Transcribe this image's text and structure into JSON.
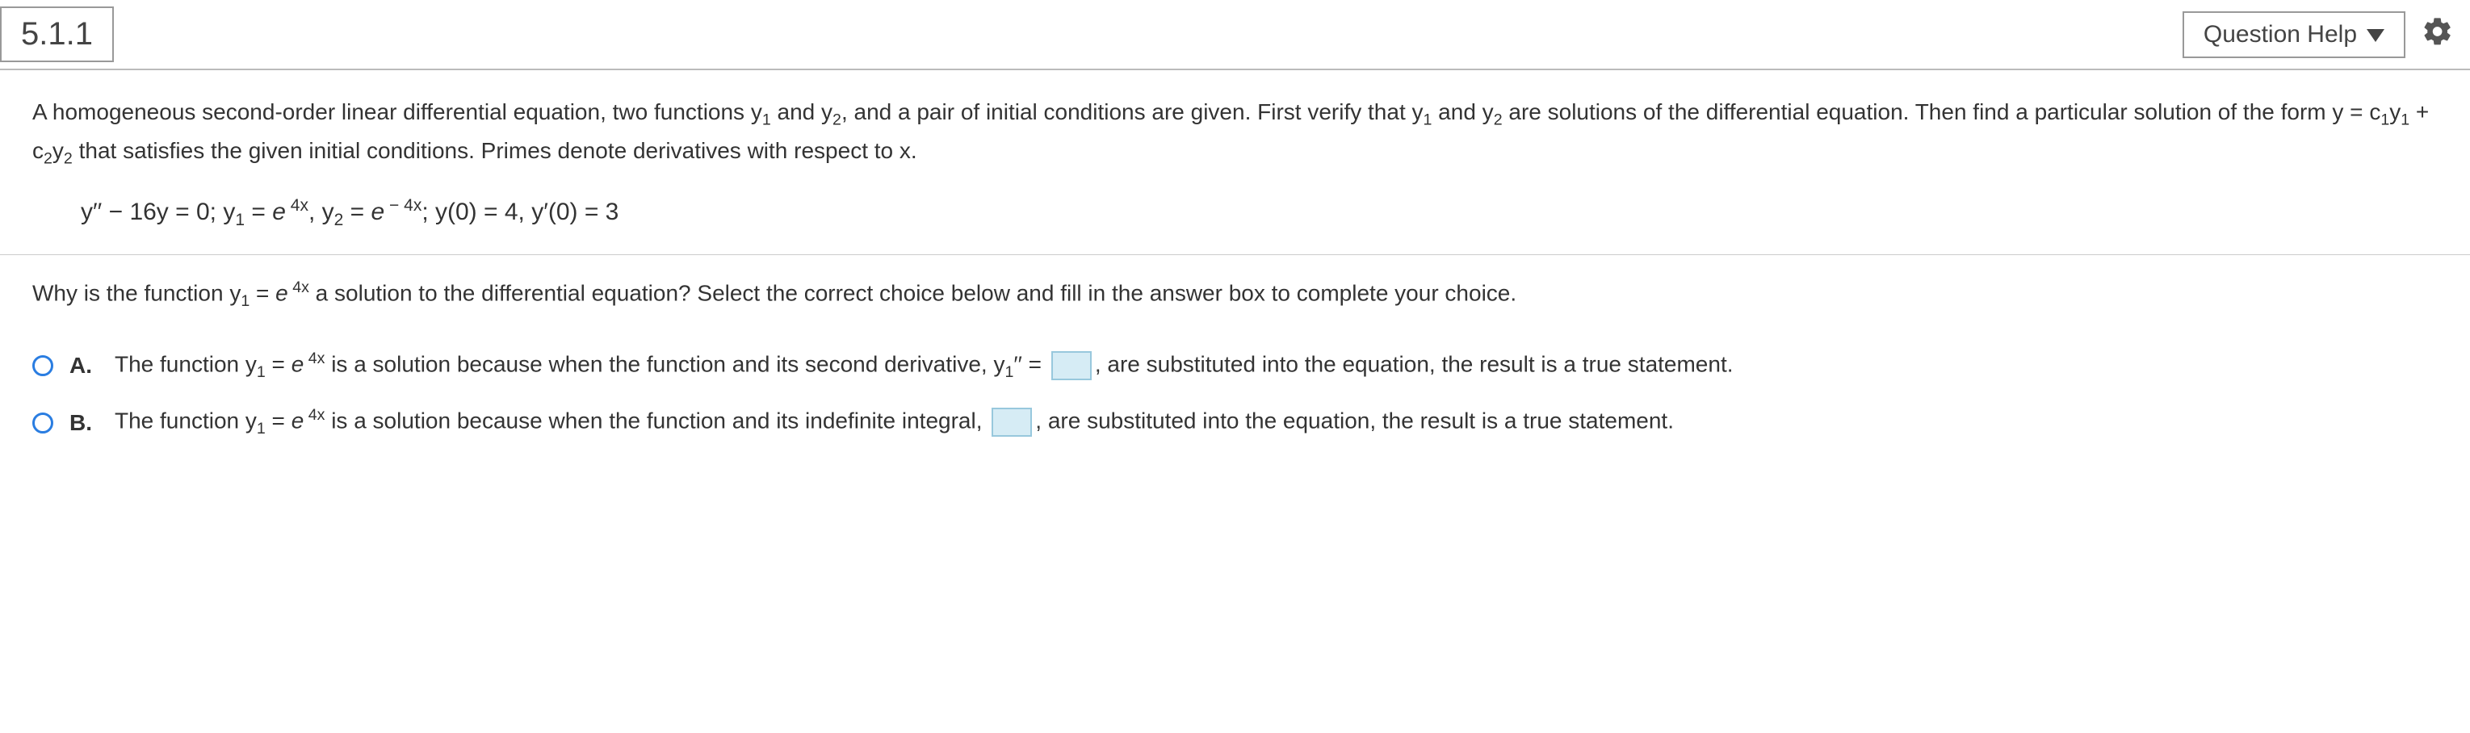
{
  "header": {
    "question_number": "5.1.1",
    "help_label": "Question Help"
  },
  "problem": {
    "intro_part1": "A homogeneous second-order linear differential equation, two functions y",
    "intro_part2": " and y",
    "intro_part3": ", and a pair of initial conditions are given. First verify that y",
    "intro_part4": " and y",
    "intro_part5": " are solutions of the differential equation. Then find a particular solution of the form y = c",
    "intro_part6": "y",
    "intro_part7": " + c",
    "intro_part8": "y",
    "intro_part9": " that satisfies the given initial conditions. Primes denote derivatives with respect to x.",
    "sub1": "1",
    "sub2": "2",
    "eq_part1": "y′′ − 16y = 0; y",
    "eq_part2": " = ",
    "eq_e": "e",
    "eq_exp1": " 4x",
    "eq_part3": ", y",
    "eq_exp2": " − 4x",
    "eq_part4": "; y(0) = 4, y′(0) = 3"
  },
  "question": {
    "q_part1": "Why is the function y",
    "q_part2": " = ",
    "q_e": "e",
    "q_exp": " 4x",
    "q_part3": " a solution to the differential equation? Select the correct choice below and fill in the answer box to complete your choice."
  },
  "choices": {
    "a": {
      "label": "A.",
      "t1": "The function y",
      "t2": " = ",
      "e": "e",
      "exp": " 4x",
      "t3": " is a solution because when the function and its second derivative, y",
      "t4": "′′ = ",
      "t5": ", are substituted into the equation, the result is a true statement."
    },
    "b": {
      "label": "B.",
      "t1": "The function y",
      "t2": " = ",
      "e": "e",
      "exp": " 4x",
      "t3": " is a solution because when the function and its indefinite integral, ",
      "t5": ", are substituted into the equation, the result is a true statement."
    }
  }
}
